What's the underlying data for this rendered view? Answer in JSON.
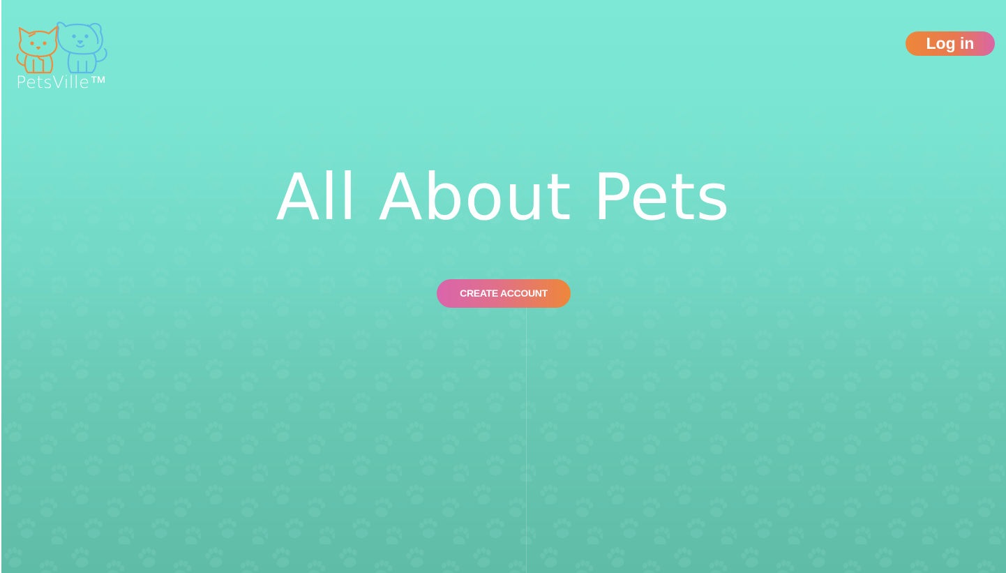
{
  "brand": {
    "name": "PetsVille™",
    "logo_icon": "cat-and-dog-icon"
  },
  "header": {
    "login_label": "Log in"
  },
  "hero": {
    "title": "All About Pets",
    "cta_label": "CREATE ACCOUNT"
  },
  "colors": {
    "background_top": "#7ce8d5",
    "background_bottom": "#5fbca7",
    "accent_orange": "#ee873a",
    "accent_pink": "#d965ac",
    "cat_orange": "#f08a3c",
    "dog_blue": "#5fb9e8",
    "text": "#ffffff"
  },
  "background": {
    "pattern_icon": "paw-print-icon"
  }
}
